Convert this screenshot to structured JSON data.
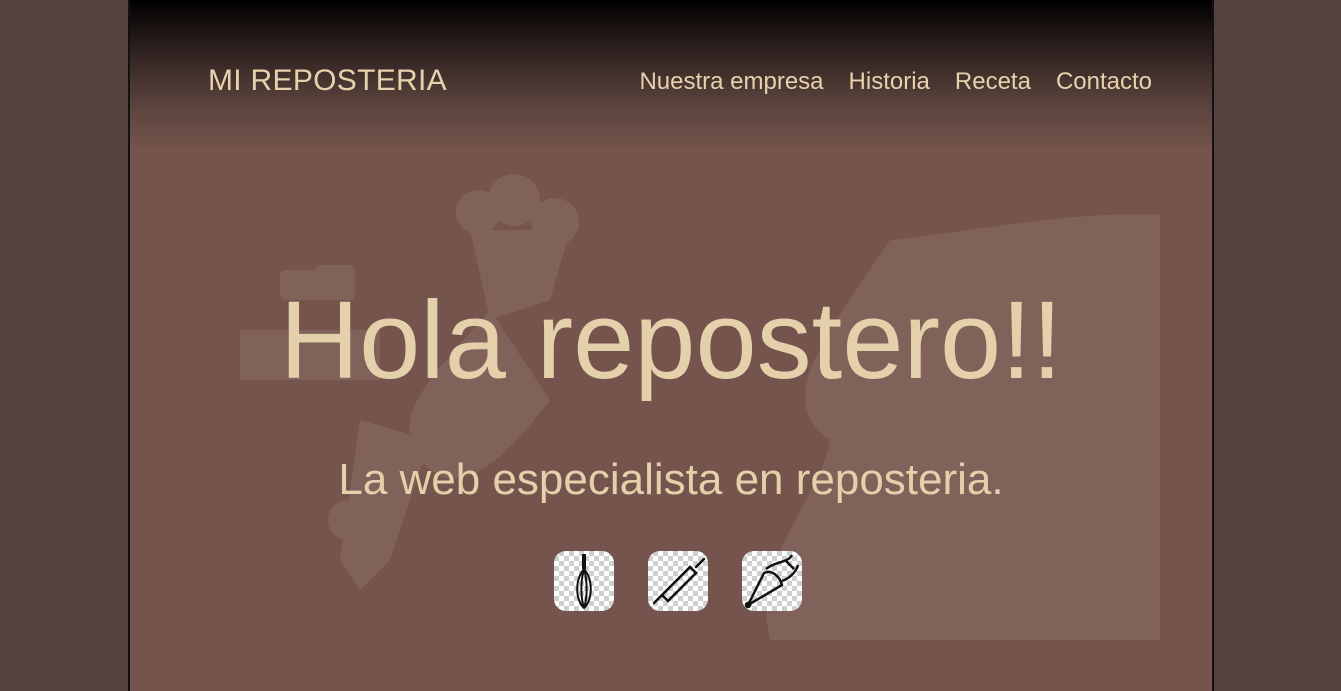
{
  "header": {
    "brand": "MI REPOSTERIA",
    "nav": [
      "Nuestra empresa",
      "Historia",
      "Receta",
      "Contacto"
    ]
  },
  "hero": {
    "title": "Hola repostero!!",
    "subtitle": "La web especialista en reposteria."
  },
  "tools": [
    {
      "icon": "whisk-icon"
    },
    {
      "icon": "rolling-pin-icon"
    },
    {
      "icon": "piping-bag-icon"
    }
  ],
  "colors": {
    "outer_background": "#564040",
    "page_background": "#74544c",
    "text_accent": "#e4d0aa"
  }
}
